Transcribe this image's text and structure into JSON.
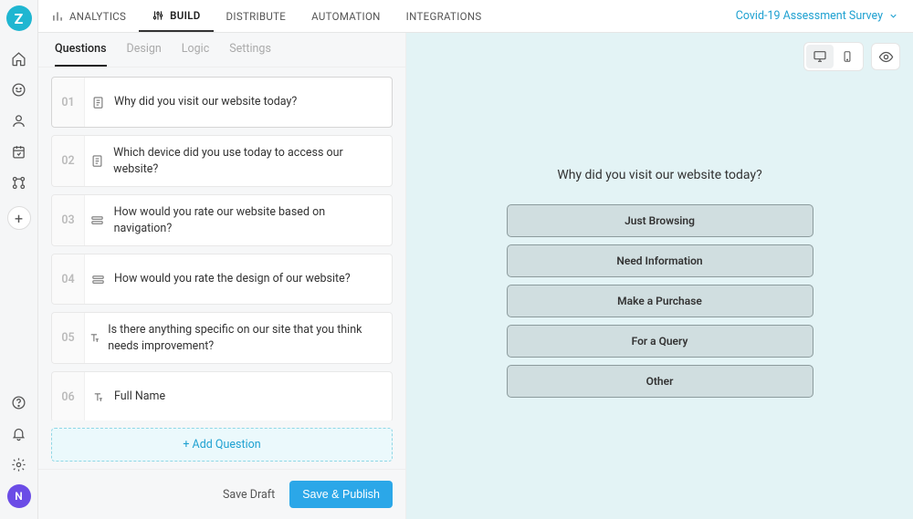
{
  "logo_letter": "Z",
  "top_tabs": {
    "analytics": "ANALYTICS",
    "build": "BUILD",
    "distribute": "DISTRIBUTE",
    "automation": "AUTOMATION",
    "integrations": "INTEGRATIONS"
  },
  "survey_name": "Covid-19 Assessment Survey",
  "sub_tabs": {
    "questions": "Questions",
    "design": "Design",
    "logic": "Logic",
    "settings": "Settings"
  },
  "questions": [
    {
      "num": "01",
      "text": "Why did you visit our website today?"
    },
    {
      "num": "02",
      "text": "Which device did you use today to access our website?"
    },
    {
      "num": "03",
      "text": "How would you rate our website based on navigation?"
    },
    {
      "num": "04",
      "text": "How would you rate the design of our website?"
    },
    {
      "num": "05",
      "text": "Is there anything specific on our site that you think needs improvement?"
    },
    {
      "num": "06",
      "text": "Full Name"
    }
  ],
  "add_question_label": "+ Add Question",
  "save_draft_label": "Save Draft",
  "publish_label": "Save & Publish",
  "preview": {
    "title": "Why did you visit our website today?",
    "options": [
      "Just Browsing",
      "Need Information",
      "Make a Purchase",
      "For a Query",
      "Other"
    ]
  },
  "avatar_letter": "N"
}
